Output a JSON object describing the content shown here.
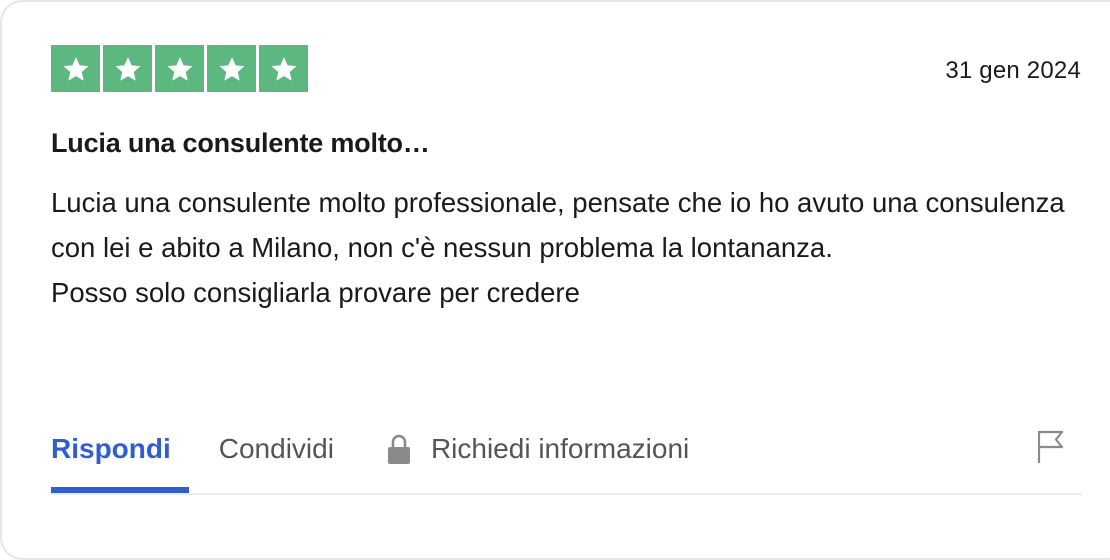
{
  "review": {
    "rating": 5,
    "rating_max": 5,
    "star_color": "#5cb87f",
    "date": "31 gen 2024",
    "title": "Lucia una consulente molto…",
    "body_lines": [
      "Lucia una consulente molto professionale, pensate che io ho avuto una consulenza con lei e abito a Milano, non c'è nessun problema la lontananza.",
      "Posso solo consigliarla provare per credere"
    ]
  },
  "actions": {
    "reply_label": "Rispondi",
    "share_label": "Condividi",
    "info_label": "Richiedi informazioni",
    "reply_icon": "none",
    "info_icon": "lock-icon",
    "report_icon": "flag-icon",
    "accent_color": "#2f5ed1"
  }
}
